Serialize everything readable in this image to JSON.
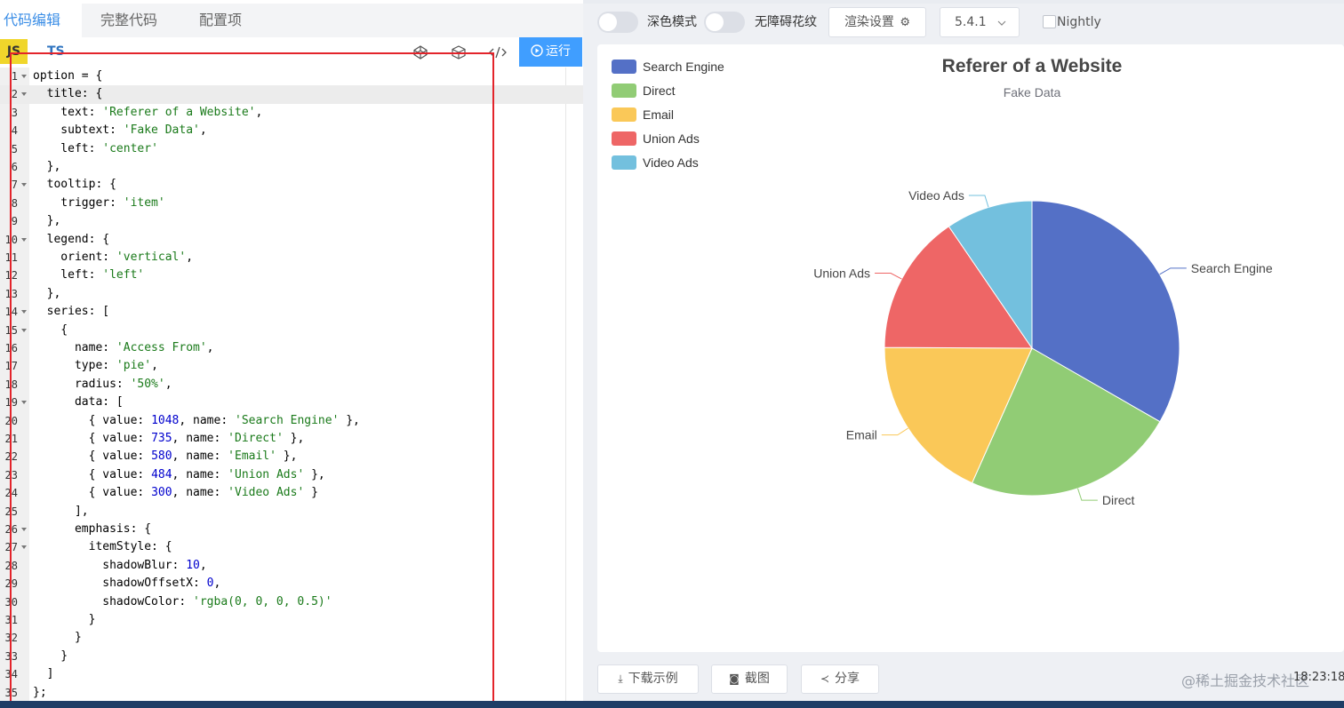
{
  "tabs": [
    {
      "label": "代码编辑",
      "active": true
    },
    {
      "label": "完整代码",
      "active": false
    },
    {
      "label": "配置项",
      "active": false
    }
  ],
  "toolbar": {
    "js_label": "JS",
    "ts_label": "TS",
    "run_label": "运行"
  },
  "code_lines": [
    {
      "num": "1",
      "fold": true,
      "code": "option = {"
    },
    {
      "num": "2",
      "fold": true,
      "code": "  title: {",
      "active": true
    },
    {
      "num": "3",
      "fold": false,
      "code": "    text: 'Referer of a Website',"
    },
    {
      "num": "4",
      "fold": false,
      "code": "    subtext: 'Fake Data',"
    },
    {
      "num": "5",
      "fold": false,
      "code": "    left: 'center'"
    },
    {
      "num": "6",
      "fold": false,
      "code": "  },"
    },
    {
      "num": "7",
      "fold": true,
      "code": "  tooltip: {"
    },
    {
      "num": "8",
      "fold": false,
      "code": "    trigger: 'item'"
    },
    {
      "num": "9",
      "fold": false,
      "code": "  },"
    },
    {
      "num": "10",
      "fold": true,
      "code": "  legend: {"
    },
    {
      "num": "11",
      "fold": false,
      "code": "    orient: 'vertical',"
    },
    {
      "num": "12",
      "fold": false,
      "code": "    left: 'left'"
    },
    {
      "num": "13",
      "fold": false,
      "code": "  },"
    },
    {
      "num": "14",
      "fold": true,
      "code": "  series: ["
    },
    {
      "num": "15",
      "fold": true,
      "code": "    {"
    },
    {
      "num": "16",
      "fold": false,
      "code": "      name: 'Access From',"
    },
    {
      "num": "17",
      "fold": false,
      "code": "      type: 'pie',"
    },
    {
      "num": "18",
      "fold": false,
      "code": "      radius: '50%',"
    },
    {
      "num": "19",
      "fold": true,
      "code": "      data: ["
    },
    {
      "num": "20",
      "fold": false,
      "code": "        { value: 1048, name: 'Search Engine' },"
    },
    {
      "num": "21",
      "fold": false,
      "code": "        { value: 735, name: 'Direct' },"
    },
    {
      "num": "22",
      "fold": false,
      "code": "        { value: 580, name: 'Email' },"
    },
    {
      "num": "23",
      "fold": false,
      "code": "        { value: 484, name: 'Union Ads' },"
    },
    {
      "num": "24",
      "fold": false,
      "code": "        { value: 300, name: 'Video Ads' }"
    },
    {
      "num": "25",
      "fold": false,
      "code": "      ],"
    },
    {
      "num": "26",
      "fold": true,
      "code": "      emphasis: {"
    },
    {
      "num": "27",
      "fold": true,
      "code": "        itemStyle: {"
    },
    {
      "num": "28",
      "fold": false,
      "code": "          shadowBlur: 10,"
    },
    {
      "num": "29",
      "fold": false,
      "code": "          shadowOffsetX: 0,"
    },
    {
      "num": "30",
      "fold": false,
      "code": "          shadowColor: 'rgba(0, 0, 0, 0.5)'"
    },
    {
      "num": "31",
      "fold": false,
      "code": "        }"
    },
    {
      "num": "32",
      "fold": false,
      "code": "      }"
    },
    {
      "num": "33",
      "fold": false,
      "code": "    }"
    },
    {
      "num": "34",
      "fold": false,
      "code": "  ]"
    },
    {
      "num": "35",
      "fold": false,
      "code": "};"
    }
  ],
  "right_toolbar": {
    "dark_mode_label": "深色模式",
    "a11y_label": "无障碍花纹",
    "render_settings_label": "渲染设置",
    "version_value": "5.4.1",
    "nightly_label": "Nightly"
  },
  "bottom_actions": {
    "download_label": "下载示例",
    "screenshot_label": "截图",
    "share_label": "分享"
  },
  "watermark": "@稀土掘金技术社区",
  "clock": "18:23:18",
  "colors": {
    "accent": "#409eff",
    "js_badge": "#f0d62b",
    "selection": "#e3242b"
  },
  "chart_data": {
    "type": "pie",
    "title": "Referer of a Website",
    "subtitle": "Fake Data",
    "legend_position": "top-left",
    "slices": [
      {
        "name": "Search Engine",
        "value": 1048,
        "color": "#5470c6"
      },
      {
        "name": "Direct",
        "value": 735,
        "color": "#91cc75"
      },
      {
        "name": "Email",
        "value": 580,
        "color": "#fac858"
      },
      {
        "name": "Union Ads",
        "value": 484,
        "color": "#ee6666"
      },
      {
        "name": "Video Ads",
        "value": 300,
        "color": "#73c0de"
      }
    ]
  }
}
